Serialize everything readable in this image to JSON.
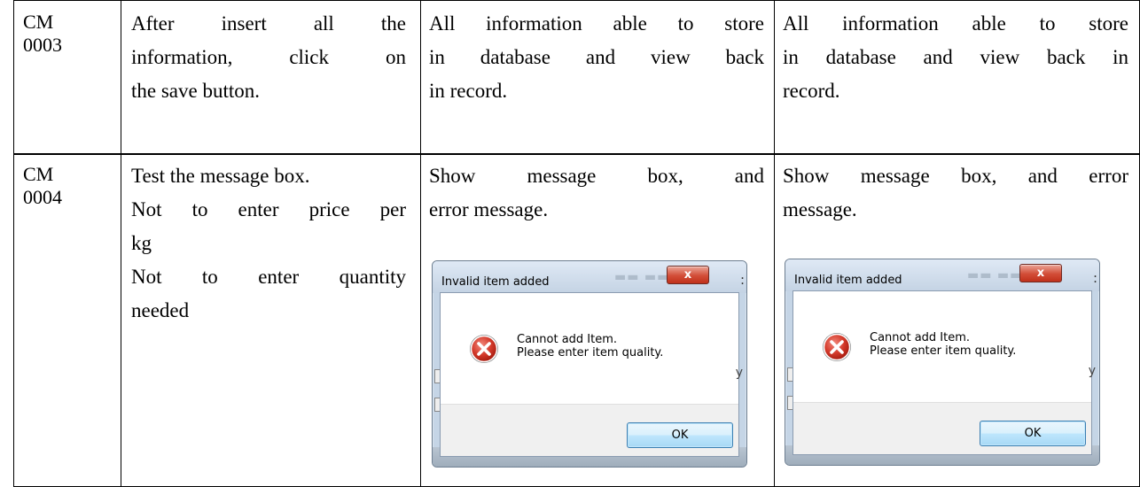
{
  "rows": [
    {
      "id_lines": [
        "CM",
        "0003"
      ],
      "procedure": [
        "After insert all the",
        "information, click on",
        "the save button."
      ],
      "expected": [
        "All information able to store",
        "in database and view back",
        "in record."
      ],
      "actual": [
        "All information able to store",
        "in database and view back in",
        "record."
      ]
    },
    {
      "id_lines": [
        "CM",
        "0004"
      ],
      "procedure": [
        "Test the message box.",
        "Not to enter price per",
        "kg",
        "Not to enter quantity",
        "needed"
      ],
      "expected": [
        "Show message box, and",
        "error message."
      ],
      "actual": [
        "Show message box, and error",
        "message."
      ]
    }
  ],
  "dialogs": [
    {
      "title": "Invalid item added",
      "close_label": "x",
      "message_line1": "Cannot add Item.",
      "message_line2": "Please enter item quality.",
      "ok_label": "OK",
      "icon": "error-icon"
    },
    {
      "title": "Invalid item added",
      "close_label": "x",
      "message_line1": "Cannot add Item.",
      "message_line2": "Please enter item quality.",
      "ok_label": "OK",
      "icon": "error-icon"
    }
  ],
  "colors": {
    "border": "#000000",
    "error_icon": "#c42a1c",
    "ok_button_border": "#3c7fb1",
    "close_button": "#d24d37"
  }
}
